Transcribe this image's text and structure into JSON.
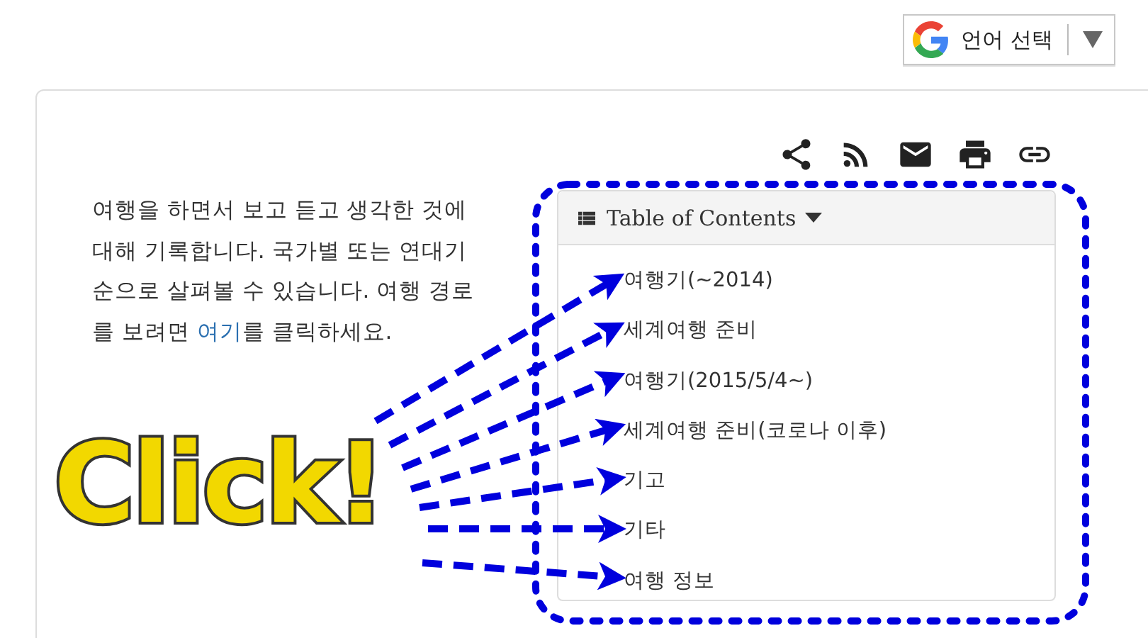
{
  "language_selector": {
    "label": "언어 선택"
  },
  "intro": {
    "before": "여행을 하면서 보고 듣고 생각한 것에 대해 기록합니다. 국가별 또는 연대기 순으로 살펴볼 수 있습니다. 여행 경로를 보려면 ",
    "link": "여기",
    "after": "를 클릭하세요."
  },
  "toc": {
    "title": "Table of Contents",
    "expanded": true,
    "items": [
      {
        "label": "여행기(~2014)"
      },
      {
        "label": "세계여행 준비"
      },
      {
        "label": "여행기(2015/5/4~)"
      },
      {
        "label": "세계여행 준비(코로나 이후)"
      },
      {
        "label": "기고"
      },
      {
        "label": "기타"
      },
      {
        "label": "여행 정보"
      }
    ]
  },
  "annotation": {
    "text": "Click!"
  }
}
